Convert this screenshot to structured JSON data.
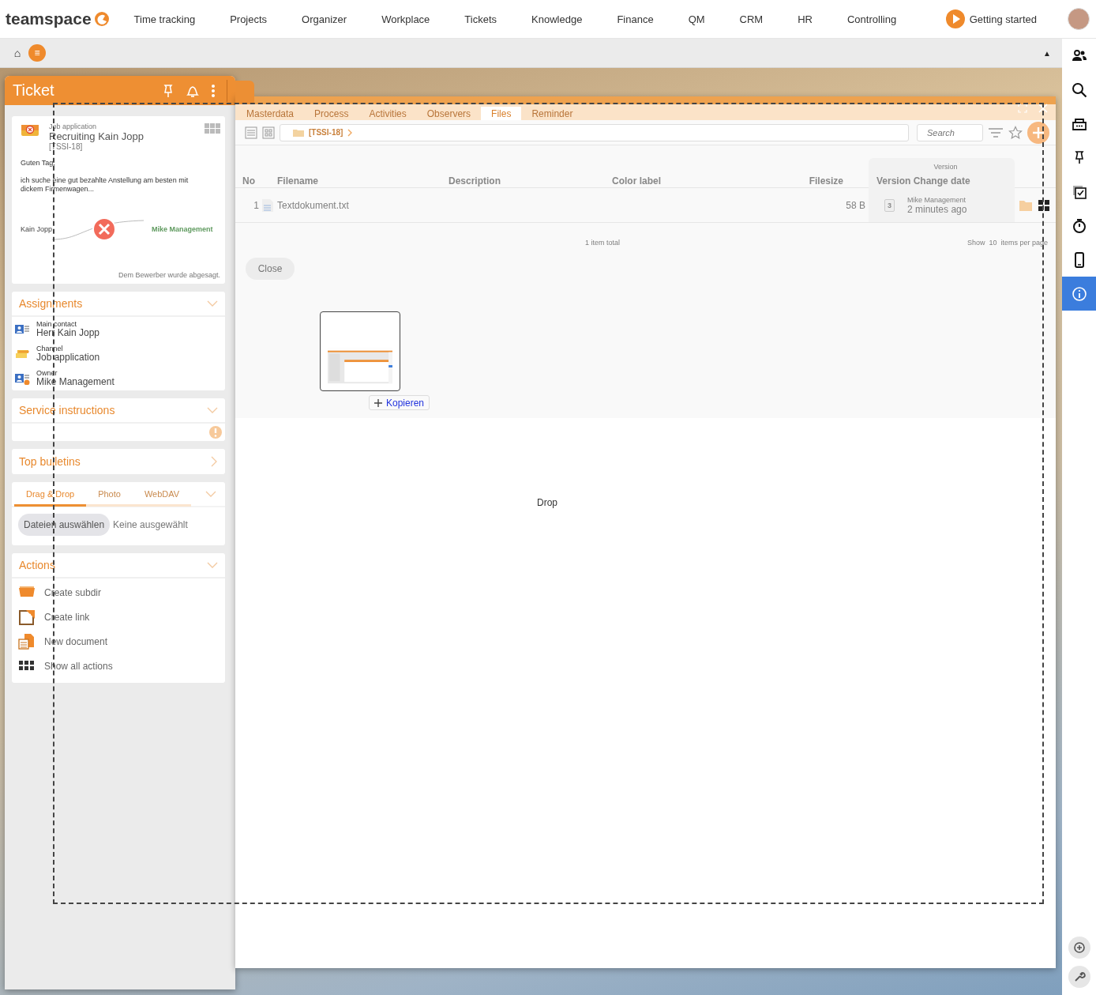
{
  "nav": {
    "logo": "teamspace",
    "items": [
      "Time tracking",
      "Projects",
      "Organizer",
      "Workplace",
      "Tickets",
      "Knowledge",
      "Finance",
      "QM",
      "CRM",
      "HR",
      "Controlling"
    ],
    "getting_started": "Getting started"
  },
  "toolbar": {
    "home": "⌂",
    "menu": "≡",
    "collapse": "▲"
  },
  "side_icons": [
    {
      "kind": "people",
      "selected": false
    },
    {
      "kind": "search",
      "selected": false
    },
    {
      "kind": "tray",
      "selected": false
    },
    {
      "kind": "pin",
      "selected": false
    },
    {
      "kind": "tasks",
      "selected": false
    },
    {
      "kind": "timer",
      "selected": false
    },
    {
      "kind": "phone",
      "selected": false
    },
    {
      "kind": "info",
      "selected": true
    }
  ],
  "ticket_panel": {
    "title": "Ticket",
    "summary": {
      "category": "Job application",
      "title": "Recruiting Kain Jopp",
      "id": "[TSSI-18]",
      "message": [
        "Guten Tag,",
        "ich suche eine gut bezahlte Anstellung am besten mit dickem Firmenwagen..."
      ],
      "from": "Kain Jopp",
      "to": "Mike Management",
      "status": "Dem Bewerber wurde abgesagt."
    },
    "assignments": {
      "title": "Assignments",
      "items": [
        {
          "kind": "contact",
          "label": "Main contact",
          "value": "Herr Kain Jopp"
        },
        {
          "kind": "channel",
          "label": "Channel",
          "value": "Job application"
        },
        {
          "kind": "owner",
          "label": "Owner",
          "value": "Mike Management"
        }
      ]
    },
    "service": {
      "title": "Service instructions"
    },
    "bulletins": {
      "title": "Top bulletins"
    },
    "upload": {
      "tabs": [
        {
          "label": "Drag & Drop",
          "selected": true
        },
        {
          "label": "Photo",
          "selected": false
        },
        {
          "label": "WebDAV",
          "selected": false
        }
      ],
      "button": "Dateien auswählen",
      "status": "Keine ausgewählt"
    },
    "actions": {
      "title": "Actions",
      "items": [
        {
          "kind": "folder",
          "label": "Create subdir"
        },
        {
          "kind": "link",
          "label": "Create link"
        },
        {
          "kind": "document",
          "label": "New document"
        },
        {
          "kind": "grid",
          "label": "Show all actions"
        }
      ]
    }
  },
  "main": {
    "tabs": [
      {
        "label": "Masterdata",
        "selected": false
      },
      {
        "label": "Process",
        "selected": false
      },
      {
        "label": "Activities",
        "selected": false
      },
      {
        "label": "Observers",
        "selected": false
      },
      {
        "label": "Files",
        "selected": true
      },
      {
        "label": "Reminder",
        "selected": false
      }
    ],
    "breadcrumb": "[TSSI-18]",
    "search": {
      "placeholder": "Search"
    },
    "columns": [
      "No",
      "Filename",
      "Description",
      "Color label",
      "Filesize"
    ],
    "version_group": "Version",
    "version_column": "Version Change date",
    "rows": [
      {
        "no": "1",
        "filename": "Textdokument.txt",
        "filesize": "58 B",
        "version": "3",
        "author": "Mike Management",
        "changed": "2 minutes ago"
      }
    ],
    "total": "1 item total",
    "pager": {
      "show": "Show",
      "count": "10",
      "suffix": "items per page"
    },
    "close": "Close"
  },
  "drop": {
    "copy_label": "Kopieren",
    "label": "Drop"
  }
}
